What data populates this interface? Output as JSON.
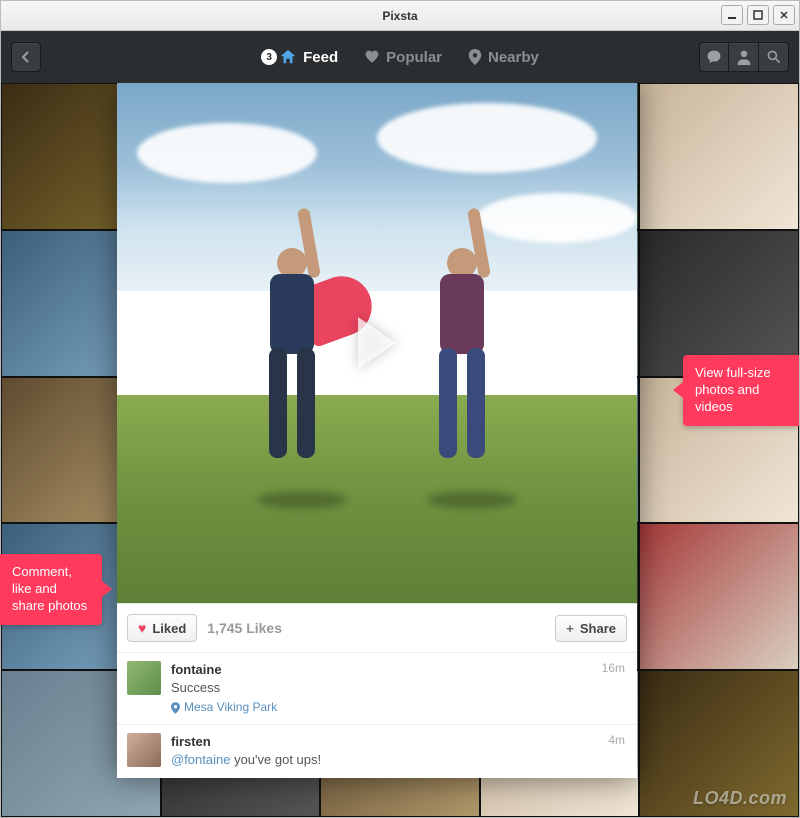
{
  "window": {
    "title": "Pixsta"
  },
  "toolbar": {
    "badge_count": "3",
    "tabs": {
      "feed": "Feed",
      "popular": "Popular",
      "nearby": "Nearby"
    }
  },
  "post": {
    "liked_button": "Liked",
    "likes_count": "1,745 Likes",
    "share_button": "Share",
    "author_username": "fontaine",
    "caption": "Success",
    "location": "Mesa Viking Park",
    "timestamp": "16m"
  },
  "comment": {
    "username": "firsten",
    "mention": "@fontaine",
    "text": " you've got ups!",
    "timestamp": "4m"
  },
  "callouts": {
    "left": "Comment, like and share photos",
    "right": "View full-size photos and videos"
  },
  "watermark": "LO4D.com"
}
